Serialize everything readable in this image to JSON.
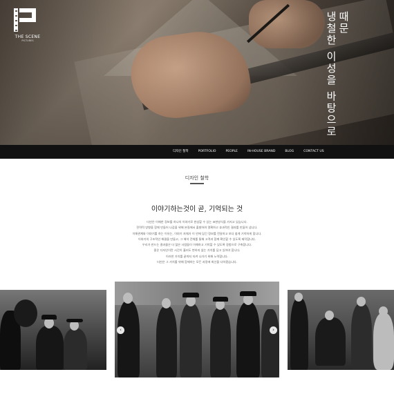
{
  "hero": {
    "logo_text": "THE SCENE",
    "logo_sub": "PICTURES",
    "vertical_lines": [
      "때문",
      "냉철한 이성을 바탕으로"
    ]
  },
  "nav": {
    "items": [
      "디자인 철학",
      "PORTFOLIO",
      "PEOPLE",
      "IN-HOUSE BRAND",
      "BLOG",
      "CONTACT US"
    ]
  },
  "philosophy": {
    "section_title": "디자인 철학",
    "headline": "이야기하는것이 곧, 기억되는 것",
    "paragraph": [
      "더씬은 이해한 정보를 하나의 이야기로 완성할 수 있는 표현방식을 가지고 있습니다.",
      "전략적 방향을 함께 만들어 나감을 위해 본질에서 출발하여 명확하고 효과적인 결과를 만들어 냅니다.",
      "이해관계와 이야기를 하는 이유는, 이야기 자체가 이 안에 담긴 정보를 전달하고 보다 쉽게 기억하게 합니다.",
      "이야기의 구조적인 해결을 만들고, 그 해석 전체를 통해 고객과 함께 확인할 수 있도록 제작합니다.",
      "우리가 만드는 결과물은 더 많은 사람들이 이해하고 기억할 수 있도록 경험으로 구축합니다.",
      "좋은 디자인이란 시간이 흘러도 변하지 않는 가치를 담고 있어야 합니다.",
      "이러한 가치를 끝까지 지켜 나가기 위해 노력합니다.",
      "더씬은 그 가치를 위해 함께하는 모든 과정에 최선을 다하겠습니다."
    ]
  },
  "gallery": {
    "prev_label": "‹",
    "next_label": "›"
  }
}
